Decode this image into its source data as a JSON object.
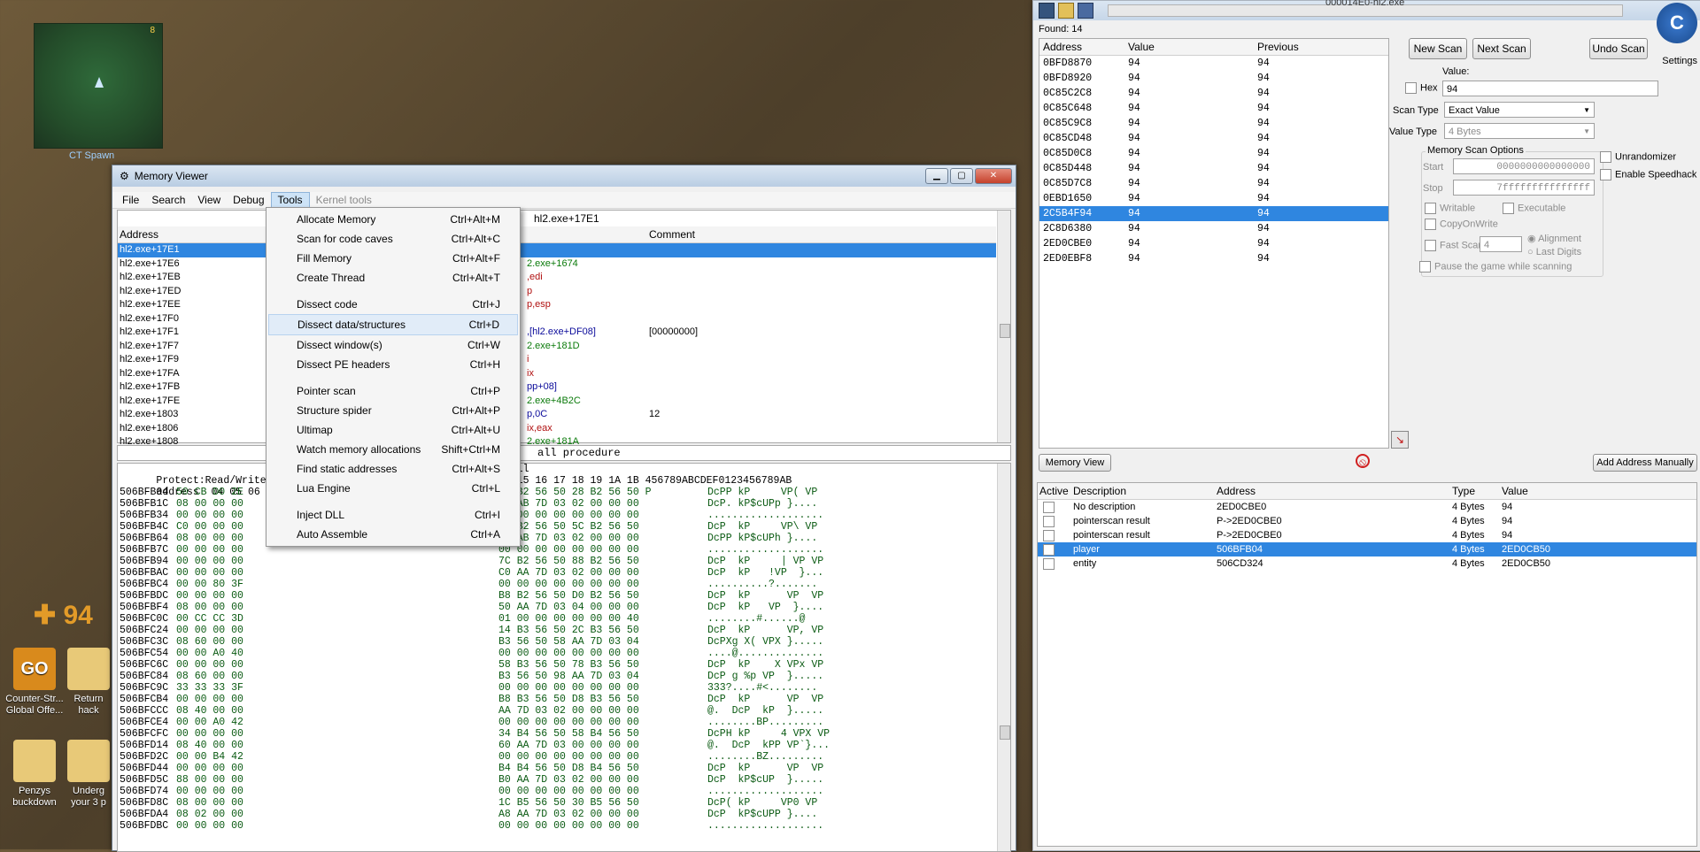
{
  "desktop": {
    "minimap_number": "8",
    "spawn_label": "CT Spawn",
    "hud_value": "94",
    "icons": [
      {
        "label": "Counter-Str... Global Offe...",
        "color": "#d98a1c"
      },
      {
        "label": "Return hack",
        "color": "#e8c978"
      },
      {
        "label": "Penzys buckdown",
        "color": "#e8c978"
      },
      {
        "label": "Underg your 3 p",
        "color": "#e8c978"
      }
    ]
  },
  "memview": {
    "title": "Memory Viewer",
    "menu": [
      "File",
      "Search",
      "View",
      "Debug",
      "Tools",
      "Kernel tools"
    ],
    "location": "hl2.exe+17E1",
    "columns": {
      "address": "Address",
      "comment": "Comment"
    },
    "addresses": [
      "hl2.exe+17E1",
      "hl2.exe+17E6",
      "hl2.exe+17EB",
      "hl2.exe+17ED",
      "hl2.exe+17EE",
      "hl2.exe+17F0",
      "hl2.exe+17F1",
      "hl2.exe+17F7",
      "hl2.exe+17F9",
      "hl2.exe+17FA",
      "hl2.exe+17FB",
      "hl2.exe+17FE",
      "hl2.exe+1803",
      "hl2.exe+1806",
      "hl2.exe+1808",
      "hl2.exe+180A"
    ],
    "opcodes": [
      {
        "t": "",
        "c": "#0a7a0a"
      },
      {
        "t": "2.exe+1674",
        "c": "#0a7a0a"
      },
      {
        "t": ",edi",
        "c": "#b01010"
      },
      {
        "t": "p",
        "c": "#b01010"
      },
      {
        "t": "p,esp",
        "c": "#b01010"
      },
      {
        "t": "",
        "c": "#b01010"
      },
      {
        "t": ",[hl2.exe+DF08]",
        "c": "#0a0a9a"
      },
      {
        "t": "2.exe+181D",
        "c": "#0a7a0a"
      },
      {
        "t": "i",
        "c": "#b01010"
      },
      {
        "t": "ix",
        "c": "#b01010"
      },
      {
        "t": "pp+08]",
        "c": "#0a0a9a"
      },
      {
        "t": "2.exe+4B2C",
        "c": "#0a7a0a"
      },
      {
        "t": "p,0C",
        "c": "#0a0a9a"
      },
      {
        "t": "ix,eax",
        "c": "#b01010"
      },
      {
        "t": "2.exe+181A",
        "c": "#0a7a0a"
      },
      {
        "t": "ix,[esi]",
        "c": "#b01010"
      }
    ],
    "comments": [
      "",
      "",
      "",
      "",
      "",
      "",
      "[00000000]",
      "",
      "",
      "",
      "",
      "",
      "12",
      "",
      "",
      ""
    ],
    "status_text": "all procedure",
    "hex_header1": "Protect:Read/Write  B",
    "hex_header1b": "t.dll",
    "hex_header2": "address  04 05 06 07",
    "hex_header2b": "14 15 16 17 18 19 1A 1B 456789ABCDEF0123456789AB",
    "hex_rows": [
      [
        "506BFB04",
        "50 CB D0 2E",
        "18 B2 56 50 28 B2 56 50 P",
        "DcPP kP     VP( VP"
      ],
      [
        "506BFB1C",
        "08 00 00 00",
        "70 AB 7D 03 02 00 00 00",
        "DcP. kP$cUPp }...."
      ],
      [
        "506BFB34",
        "00 00 00 00",
        "00 00 00 00 00 00 00 00",
        "..................."
      ],
      [
        "506BFB4C",
        "C0 00 00 00",
        "50 B2 56 50 5C B2 56 50",
        "DcP  kP     VP\\ VP"
      ],
      [
        "506BFB64",
        "08 00 00 00",
        "68 AB 7D 03 02 00 00 00",
        "DcPP kP$cUPh }...."
      ],
      [
        "506BFB7C",
        "00 00 00 00",
        "00 00 00 00 00 00 00 00",
        "..................."
      ],
      [
        "506BFB94",
        "00 00 00 00",
        "7C B2 56 50 88 B2 56 50",
        "DcP  kP     | VP VP"
      ],
      [
        "506BFBAC",
        "00 00 00 00",
        "C0 AA 7D 03 02 00 00 00",
        "DcP  kP   !VP  }..."
      ],
      [
        "506BFBC4",
        "00 00 80 3F",
        "00 00 00 00 00 00 00 00",
        "..........?......."
      ],
      [
        "506BFBDC",
        "00 00 00 00",
        "B8 B2 56 50 D0 B2 56 50",
        "DcP  kP      VP  VP"
      ],
      [
        "506BFBF4",
        "08 00 00 00",
        "50 AA 7D 03 04 00 00 00",
        "DcP  kP   VP  }...."
      ],
      [
        "506BFC0C",
        "00 CC CC 3D",
        "01 00 00 00 00 00 00 40",
        "........#......@"
      ],
      [
        "506BFC24",
        "00 00 00 00",
        "14 B3 56 50 2C B3 56 50",
        "DcP  kP      VP, VP"
      ],
      [
        "506BFC3C",
        "08 60 00 00",
        "B3 56 50 58 AA 7D 03 04",
        "DcPXg X( VPX }....."
      ],
      [
        "506BFC54",
        "00 00 A0 40",
        "00 00 00 00 00 00 00 00",
        "....@.............."
      ],
      [
        "506BFC6C",
        "00 00 00 00",
        "58 B3 56 50 78 B3 56 50",
        "DcP  kP    X VPx VP"
      ],
      [
        "506BFC84",
        "08 60 00 00",
        "B3 56 50 98 AA 7D 03 04",
        "DcP g %p VP  }....."
      ],
      [
        "506BFC9C",
        "33 33 33 3F",
        "00 00 00 00 00 00 00 00",
        "333?....#<........"
      ],
      [
        "506BFCB4",
        "00 00 00 00",
        "B8 B3 56 50 D8 B3 56 50",
        "DcP  kP      VP  VP"
      ],
      [
        "506BFCCC",
        "08 40 00 00",
        "AA 7D 03 02 00 00 00 00",
        "@.  DcP  kP  }....."
      ],
      [
        "506BFCE4",
        "00 00 A0 42",
        "00 00 00 00 00 00 00 00",
        "........BP........."
      ],
      [
        "506BFCFC",
        "00 00 00 00",
        "34 B4 56 50 58 B4 56 50",
        "DcPH kP     4 VPX VP"
      ],
      [
        "506BFD14",
        "08 40 00 00",
        "60 AA 7D 03 00 00 00 00",
        "@.  DcP  kPP VP`}..."
      ],
      [
        "506BFD2C",
        "00 00 B4 42",
        "00 00 00 00 00 00 00 00",
        "........BZ........."
      ],
      [
        "506BFD44",
        "00 00 00 00",
        "B4 B4 56 50 D8 B4 56 50",
        "DcP  kP      VP  VP"
      ],
      [
        "506BFD5C",
        "88 00 00 00",
        "B0 AA 7D 03 02 00 00 00",
        "DcP  kP$cUP  }....."
      ],
      [
        "506BFD74",
        "00 00 00 00",
        "00 00 00 00 00 00 00 00",
        "..................."
      ],
      [
        "506BFD8C",
        "08 00 00 00",
        "1C B5 56 50 30 B5 56 50",
        "DcP( kP     VP0 VP"
      ],
      [
        "506BFDA4",
        "08 02 00 00",
        "A8 AA 7D 03 02 00 00 00",
        "DcP  kP$cUPP }...."
      ],
      [
        "506BFDBC",
        "00 00 00 00",
        "00 00 00 00 00 00 00 00",
        "..................."
      ]
    ]
  },
  "tools_menu": [
    {
      "label": "Allocate Memory",
      "shortcut": "Ctrl+Alt+M"
    },
    {
      "label": "Scan for code caves",
      "shortcut": "Ctrl+Alt+C"
    },
    {
      "label": "Fill Memory",
      "shortcut": "Ctrl+Alt+F"
    },
    {
      "label": "Create Thread",
      "shortcut": "Ctrl+Alt+T"
    },
    {
      "sep": true
    },
    {
      "label": "Dissect code",
      "shortcut": "Ctrl+J"
    },
    {
      "label": "Dissect data/structures",
      "shortcut": "Ctrl+D",
      "highlighted": true
    },
    {
      "label": "Dissect window(s)",
      "shortcut": "Ctrl+W"
    },
    {
      "label": "Dissect PE headers",
      "shortcut": "Ctrl+H"
    },
    {
      "sep": true
    },
    {
      "label": "Pointer scan",
      "shortcut": "Ctrl+P"
    },
    {
      "label": "Structure spider",
      "shortcut": "Ctrl+Alt+P"
    },
    {
      "label": "Ultimap",
      "shortcut": "Ctrl+Alt+U"
    },
    {
      "label": "Watch memory allocations",
      "shortcut": "Shift+Ctrl+M"
    },
    {
      "label": "Find static addresses",
      "shortcut": "Ctrl+Alt+S"
    },
    {
      "label": "Lua Engine",
      "shortcut": "Ctrl+L"
    },
    {
      "sep": true
    },
    {
      "label": "Inject DLL",
      "shortcut": "Ctrl+I"
    },
    {
      "label": "Auto Assemble",
      "shortcut": "Ctrl+A"
    }
  ],
  "ce": {
    "title": "000014E0-hl2.exe",
    "found": "Found: 14",
    "columns": {
      "address": "Address",
      "value": "Value",
      "previous": "Previous"
    },
    "results": [
      [
        "0BFD8870",
        "94",
        "94"
      ],
      [
        "0BFD8920",
        "94",
        "94"
      ],
      [
        "0C85C2C8",
        "94",
        "94"
      ],
      [
        "0C85C648",
        "94",
        "94"
      ],
      [
        "0C85C9C8",
        "94",
        "94"
      ],
      [
        "0C85CD48",
        "94",
        "94"
      ],
      [
        "0C85D0C8",
        "94",
        "94"
      ],
      [
        "0C85D448",
        "94",
        "94"
      ],
      [
        "0C85D7C8",
        "94",
        "94"
      ],
      [
        "0EBD1650",
        "94",
        "94"
      ],
      [
        "2C5B4F94",
        "94",
        "94"
      ],
      [
        "2C8D6380",
        "94",
        "94"
      ],
      [
        "2ED0CBE0",
        "94",
        "94"
      ],
      [
        "2ED0EBF8",
        "94",
        "94"
      ]
    ],
    "selected_result": 10,
    "new_scan": "New Scan",
    "next_scan": "Next Scan",
    "undo_scan": "Undo Scan",
    "settings": "Settings",
    "value_label": "Value:",
    "hex_label": "Hex",
    "value": "94",
    "scan_type_label": "Scan Type",
    "scan_type": "Exact Value",
    "value_type_label": "Value Type",
    "value_type": "4 Bytes",
    "mem_opts": "Memory Scan Options",
    "start_label": "Start",
    "start": "0000000000000000",
    "stop_label": "Stop",
    "stop": "7fffffffffffffff",
    "writable": "Writable",
    "executable": "Executable",
    "copyonwrite": "CopyOnWrite",
    "fastscan": "Fast Scan",
    "fastscan_value": "4",
    "alignment": "Alignment",
    "lastdigits": "Last Digits",
    "pause": "Pause the game while scanning",
    "unrandomizer": "Unrandomizer",
    "speedhack": "Enable Speedhack",
    "memory_view": "Memory View",
    "add_address": "Add Address Manually",
    "table_columns": {
      "active": "Active",
      "description": "Description",
      "address": "Address",
      "type": "Type",
      "value": "Value"
    },
    "table": [
      {
        "desc": "No description",
        "addr": "2ED0CBE0",
        "type": "4 Bytes",
        "value": "94"
      },
      {
        "desc": "pointerscan result",
        "addr": "P->2ED0CBE0",
        "type": "4 Bytes",
        "value": "94"
      },
      {
        "desc": "pointerscan result",
        "addr": "P->2ED0CBE0",
        "type": "4 Bytes",
        "value": "94"
      },
      {
        "desc": "player",
        "addr": "506BFB04",
        "type": "4 Bytes",
        "value": "2ED0CB50"
      },
      {
        "desc": "entity",
        "addr": "506CD324",
        "type": "4 Bytes",
        "value": "2ED0CB50"
      }
    ],
    "selected_table": 3,
    "colors": {
      "selection": "#2f86e0",
      "panel": "#f0f0f0"
    }
  }
}
